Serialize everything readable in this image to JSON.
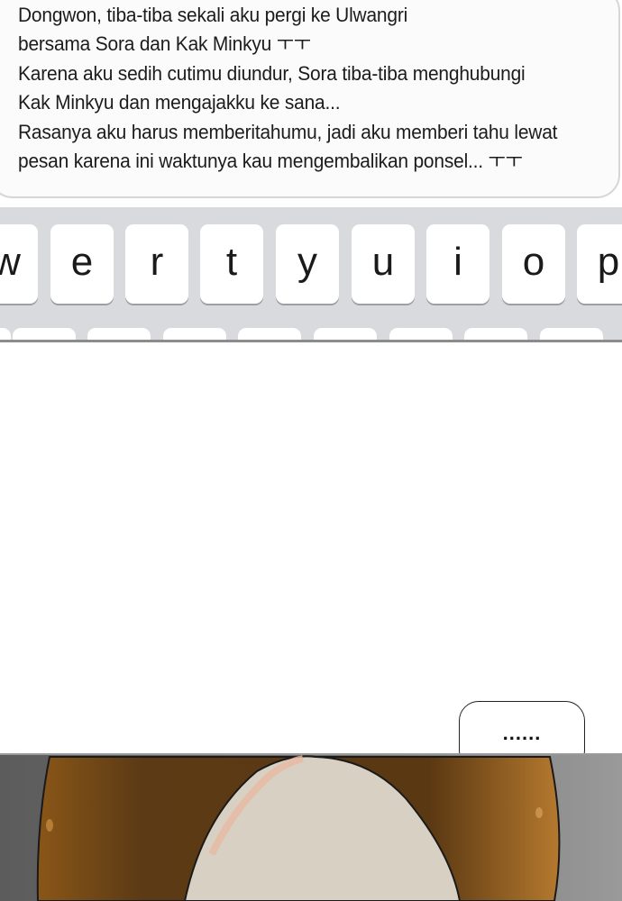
{
  "message": {
    "lines": [
      "Dongwon, tiba-tiba sekali aku pergi ke Ulwangri",
      "bersama Sora dan Kak Minkyu ㅜㅜ",
      "Karena aku sedih cutimu diundur, Sora tiba-tiba menghubungi",
      "Kak Minkyu dan mengajakku ke sana...",
      "Rasanya aku harus memberitahumu, jadi aku memberi tahu lewat",
      "pesan karena ini waktunya kau mengembalikan ponsel... ㅜㅜ"
    ]
  },
  "keyboard": {
    "row1": [
      "w",
      "e",
      "r",
      "t",
      "y",
      "u",
      "i",
      "o",
      "p"
    ]
  },
  "reaction_bubble": {
    "text": "......"
  },
  "colors": {
    "bubble_background": "#fbfbfb",
    "keyboard_background": "#d8dadd",
    "key_background": "#ffffff",
    "hair": "#6a3e14",
    "skin": "#d9d0c4",
    "background_gray": "#7a7a7a"
  }
}
